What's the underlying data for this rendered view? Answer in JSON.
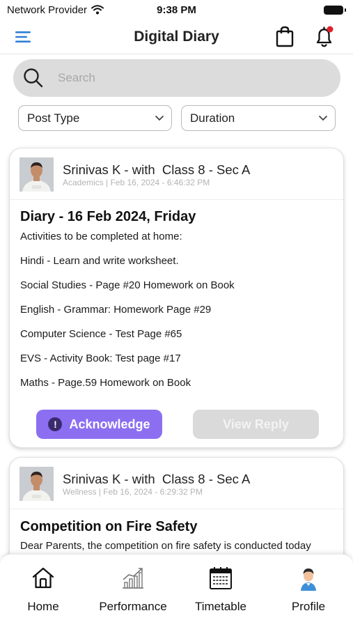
{
  "status_bar": {
    "carrier": "Network Provider",
    "time": "9:38 PM"
  },
  "header": {
    "title": "Digital Diary"
  },
  "search": {
    "placeholder": "Search"
  },
  "filters": {
    "post_type": "Post Type",
    "duration": "Duration"
  },
  "posts": [
    {
      "author": "Srinivas K - with  Class 8 - Sec A",
      "meta": "Academics | Feb 16, 2024 - 6:46:32 PM",
      "title": "Diary - 16 Feb 2024, Friday",
      "lines": [
        "Activities to be completed at home:",
        "Hindi - Learn and write worksheet.",
        "Social Studies - Page #20 Homework on Book",
        "English - Grammar: Homework Page #29",
        "Computer Science - Test Page #65",
        "EVS - Activity Book: Test page #17",
        "Maths - Page.59 Homework on Book"
      ],
      "acknowledge_label": "Acknowledge",
      "view_reply_label": "View Reply"
    },
    {
      "author": "Srinivas K - with  Class 8 - Sec A",
      "meta": "Wellness | Feb 16, 2024 - 6:29:32 PM",
      "title": "Competition on Fire Safety",
      "lines": [
        "Dear Parents, the competition on fire safety is conducted today"
      ]
    }
  ],
  "bottom_nav": [
    {
      "label": "Home",
      "icon": "home-icon"
    },
    {
      "label": "Performance",
      "icon": "performance-chart-icon"
    },
    {
      "label": "Timetable",
      "icon": "timetable-icon"
    },
    {
      "label": "Profile",
      "icon": "profile-avatar-icon"
    }
  ],
  "colors": {
    "accent": "#8c6ff1",
    "notification_dot": "#e0202a",
    "menu_icon": "#2f7fd6"
  }
}
